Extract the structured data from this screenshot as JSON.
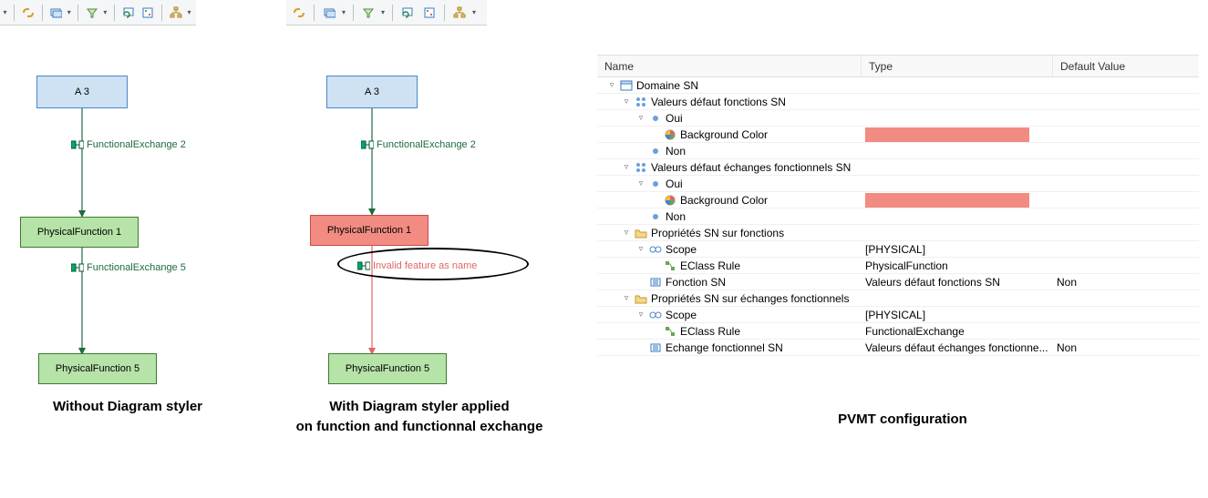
{
  "toolbar": {
    "icons": [
      "link-icon",
      "layers-icon",
      "filter-icon",
      "refresh-diagram-icon",
      "show-hide-icon",
      "layout-tree-icon"
    ]
  },
  "diagramLeft": {
    "caption": "Without Diagram styler",
    "nodeA": "A 3",
    "edge1": "FunctionalExchange 2",
    "nodePF1": "PhysicalFunction 1",
    "edge2": "FunctionalExchange 5",
    "nodePF5": "PhysicalFunction 5"
  },
  "diagramRight": {
    "caption1": "With Diagram styler applied",
    "caption2": "on function and functionnal exchange",
    "nodeA": "A 3",
    "edge1": "FunctionalExchange 2",
    "nodePF1": "PhysicalFunction 1",
    "edge2": "Invalid feature as name",
    "nodePF5": "PhysicalFunction 5"
  },
  "table": {
    "caption": "PVMT configuration",
    "headers": {
      "name": "Name",
      "type": "Type",
      "default": "Default Value"
    },
    "rows": [
      {
        "indent": 0,
        "expander": "▿",
        "icon": "domain-icon",
        "label": "Domaine SN",
        "type": "",
        "default": ""
      },
      {
        "indent": 1,
        "expander": "▿",
        "icon": "enum-icon",
        "label": "Valeurs défaut fonctions SN",
        "type": "",
        "default": ""
      },
      {
        "indent": 2,
        "expander": "▿",
        "icon": "literal-icon",
        "label": "Oui",
        "type": "",
        "default": ""
      },
      {
        "indent": 3,
        "expander": "",
        "icon": "color-icon",
        "label": "Background Color",
        "type": "SWATCH",
        "default": ""
      },
      {
        "indent": 2,
        "expander": "",
        "icon": "literal-icon",
        "label": "Non",
        "type": "",
        "default": ""
      },
      {
        "indent": 1,
        "expander": "▿",
        "icon": "enum-icon",
        "label": "Valeurs défaut échanges fonctionnels SN",
        "type": "",
        "default": ""
      },
      {
        "indent": 2,
        "expander": "▿",
        "icon": "literal-icon",
        "label": "Oui",
        "type": "",
        "default": ""
      },
      {
        "indent": 3,
        "expander": "",
        "icon": "color-icon",
        "label": "Background Color",
        "type": "SWATCH",
        "default": ""
      },
      {
        "indent": 2,
        "expander": "",
        "icon": "literal-icon",
        "label": "Non",
        "type": "",
        "default": ""
      },
      {
        "indent": 1,
        "expander": "▿",
        "icon": "folder-icon",
        "label": "Propriétés SN sur fonctions",
        "type": "",
        "default": ""
      },
      {
        "indent": 2,
        "expander": "▿",
        "icon": "scope-icon",
        "label": "Scope",
        "type": "[PHYSICAL]",
        "default": ""
      },
      {
        "indent": 3,
        "expander": "",
        "icon": "rule-icon",
        "label": "EClass Rule",
        "type": "PhysicalFunction",
        "default": ""
      },
      {
        "indent": 2,
        "expander": "",
        "icon": "prop-icon",
        "label": "Fonction SN",
        "type": "Valeurs défaut fonctions SN",
        "default": "Non"
      },
      {
        "indent": 1,
        "expander": "▿",
        "icon": "folder-icon",
        "label": "Propriétés SN sur échanges fonctionnels",
        "type": "",
        "default": ""
      },
      {
        "indent": 2,
        "expander": "▿",
        "icon": "scope-icon",
        "label": "Scope",
        "type": "[PHYSICAL]",
        "default": ""
      },
      {
        "indent": 3,
        "expander": "",
        "icon": "rule-icon",
        "label": "EClass Rule",
        "type": "FunctionalExchange",
        "default": ""
      },
      {
        "indent": 2,
        "expander": "",
        "icon": "prop-icon",
        "label": "Echange fonctionnel SN",
        "type": "Valeurs défaut échanges fonctionne...",
        "default": "Non"
      }
    ]
  },
  "colors": {
    "swatch": "#f28b82",
    "edgeGreen": "#1c6b3f",
    "edgeRed": "#e06666"
  }
}
